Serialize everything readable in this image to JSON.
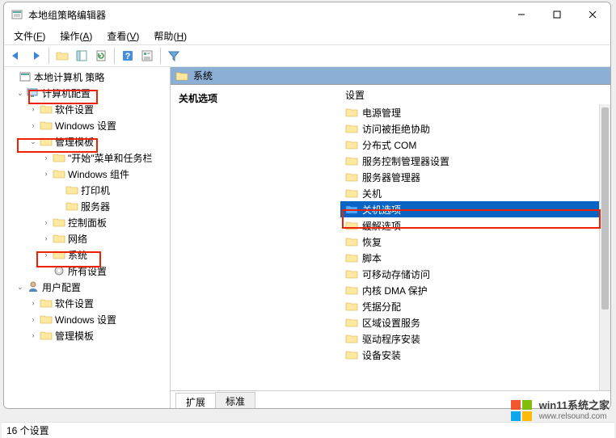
{
  "window": {
    "title": "本地组策略编辑器"
  },
  "menubar": {
    "items": [
      {
        "label": "文件",
        "key": "F"
      },
      {
        "label": "操作",
        "key": "A"
      },
      {
        "label": "查看",
        "key": "V"
      },
      {
        "label": "帮助",
        "key": "H"
      }
    ]
  },
  "tree": {
    "root": "本地计算机 策略",
    "computer_config": "计算机配置",
    "software_settings": "软件设置",
    "windows_settings": "Windows 设置",
    "admin_templates": "管理模板",
    "start_menu_taskbar": "\"开始\"菜单和任务栏",
    "windows_components": "Windows 组件",
    "printers": "打印机",
    "servers": "服务器",
    "control_panel": "控制面板",
    "network": "网络",
    "system": "系统",
    "all_settings": "所有设置",
    "user_config": "用户配置",
    "user_software_settings": "软件设置",
    "user_windows_settings": "Windows 设置",
    "user_admin_templates": "管理模板"
  },
  "right": {
    "path_label": "系统",
    "title": "关机选项",
    "column_header": "设置",
    "items": [
      "电源管理",
      "访问被拒绝协助",
      "分布式 COM",
      "服务控制管理器设置",
      "服务器管理器",
      "关机",
      "关机选项",
      "缓解选项",
      "恢复",
      "脚本",
      "可移动存储访问",
      "内核 DMA 保护",
      "凭据分配",
      "区域设置服务",
      "驱动程序安装",
      "设备安装"
    ],
    "selected_index": 6
  },
  "tabs": {
    "extended": "扩展",
    "standard": "标准"
  },
  "status": {
    "text": "16 个设置"
  },
  "watermark": {
    "line1": "win11系统之家",
    "line2": "www.relsound.com"
  }
}
